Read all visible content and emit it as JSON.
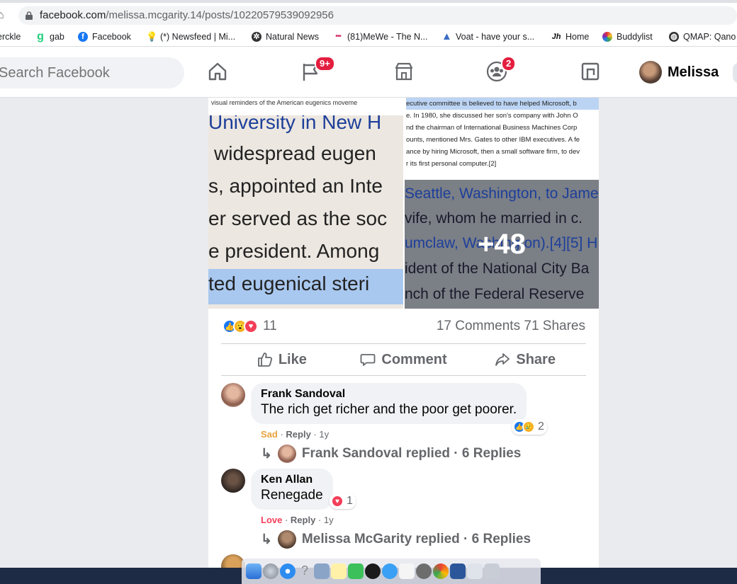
{
  "browser": {
    "url_host": "facebook.com",
    "url_path": "/melissa.mcgarity.14/posts/10220579539092956"
  },
  "bookmarks": [
    {
      "label": "erckle",
      "icon": "bookmark-icon"
    },
    {
      "label": "gab",
      "icon": "gab-icon",
      "color": "#21cf7a"
    },
    {
      "label": "Facebook",
      "icon": "facebook-icon",
      "color": "#1877f2"
    },
    {
      "label": "(*) Newsfeed | Mi...",
      "icon": "lightbulb-icon",
      "color": "#f5c518"
    },
    {
      "label": "Natural News",
      "icon": "naturalnews-icon",
      "color": "#333333"
    },
    {
      "label": "(81)MeWe - The N...",
      "icon": "mewe-icon"
    },
    {
      "label": "Voat - have your s...",
      "icon": "voat-icon",
      "color": "#3b6cc5"
    },
    {
      "label": "Home",
      "icon": "jh-icon"
    },
    {
      "label": "Buddylist",
      "icon": "buddylist-icon"
    },
    {
      "label": "QMAP: Qano",
      "icon": "qmap-icon",
      "color": "#333333"
    }
  ],
  "fbnav": {
    "search_placeholder": "Search Facebook",
    "watch_badge": "9+",
    "groups_badge": "2",
    "profile_name": "Melissa"
  },
  "photos": {
    "top_left_caption": "visual reminders of the American eugenics moveme",
    "left_lines": [
      "University in New H",
      "widespread eugen",
      "s, appointed an Inte",
      "er served as the soc",
      "e president. Among",
      "ted eugenical steri"
    ],
    "top_right_lines": [
      "ecutive committee is believed to have helped Microsoft, b",
      "e. In 1980, she discussed her son's company with John O",
      "nd the chairman of International Business Machines Corp",
      "ounts, mentioned Mrs. Gates to other IBM executives. A fe",
      "ance by hiring Microsoft, then a small software firm, to dev",
      "r its first personal computer.[2]"
    ],
    "right_lines": [
      "Seattle, Washington, to Jame",
      "vife, whom he married in c.",
      "umclaw, Washington).[4][5] H",
      "ident of the National City Ba",
      "nch of the Federal Reserve"
    ],
    "more_count": "+48"
  },
  "stats": {
    "reaction_count": "11",
    "comments": "17 Comments",
    "shares": "71 Shares"
  },
  "actions": {
    "like": "Like",
    "comment": "Comment",
    "share": "Share"
  },
  "comments": [
    {
      "author": "Frank Sandoval",
      "text": "The rich get richer and the poor get poorer.",
      "reaction_label": "Sad",
      "reaction_color": "#e9a23b",
      "reply": "Reply",
      "age": "1y",
      "reaction_count": "2",
      "replies": "Frank Sandoval replied · 6 Replies"
    },
    {
      "author": "Ken Allan",
      "text": "Renegade",
      "reaction_label": "Love",
      "reaction_color": "#f33e58",
      "reply": "Reply",
      "age": "1y",
      "reaction_count": "1",
      "replies": "Melissa McGarity replied · 6 Replies"
    }
  ]
}
